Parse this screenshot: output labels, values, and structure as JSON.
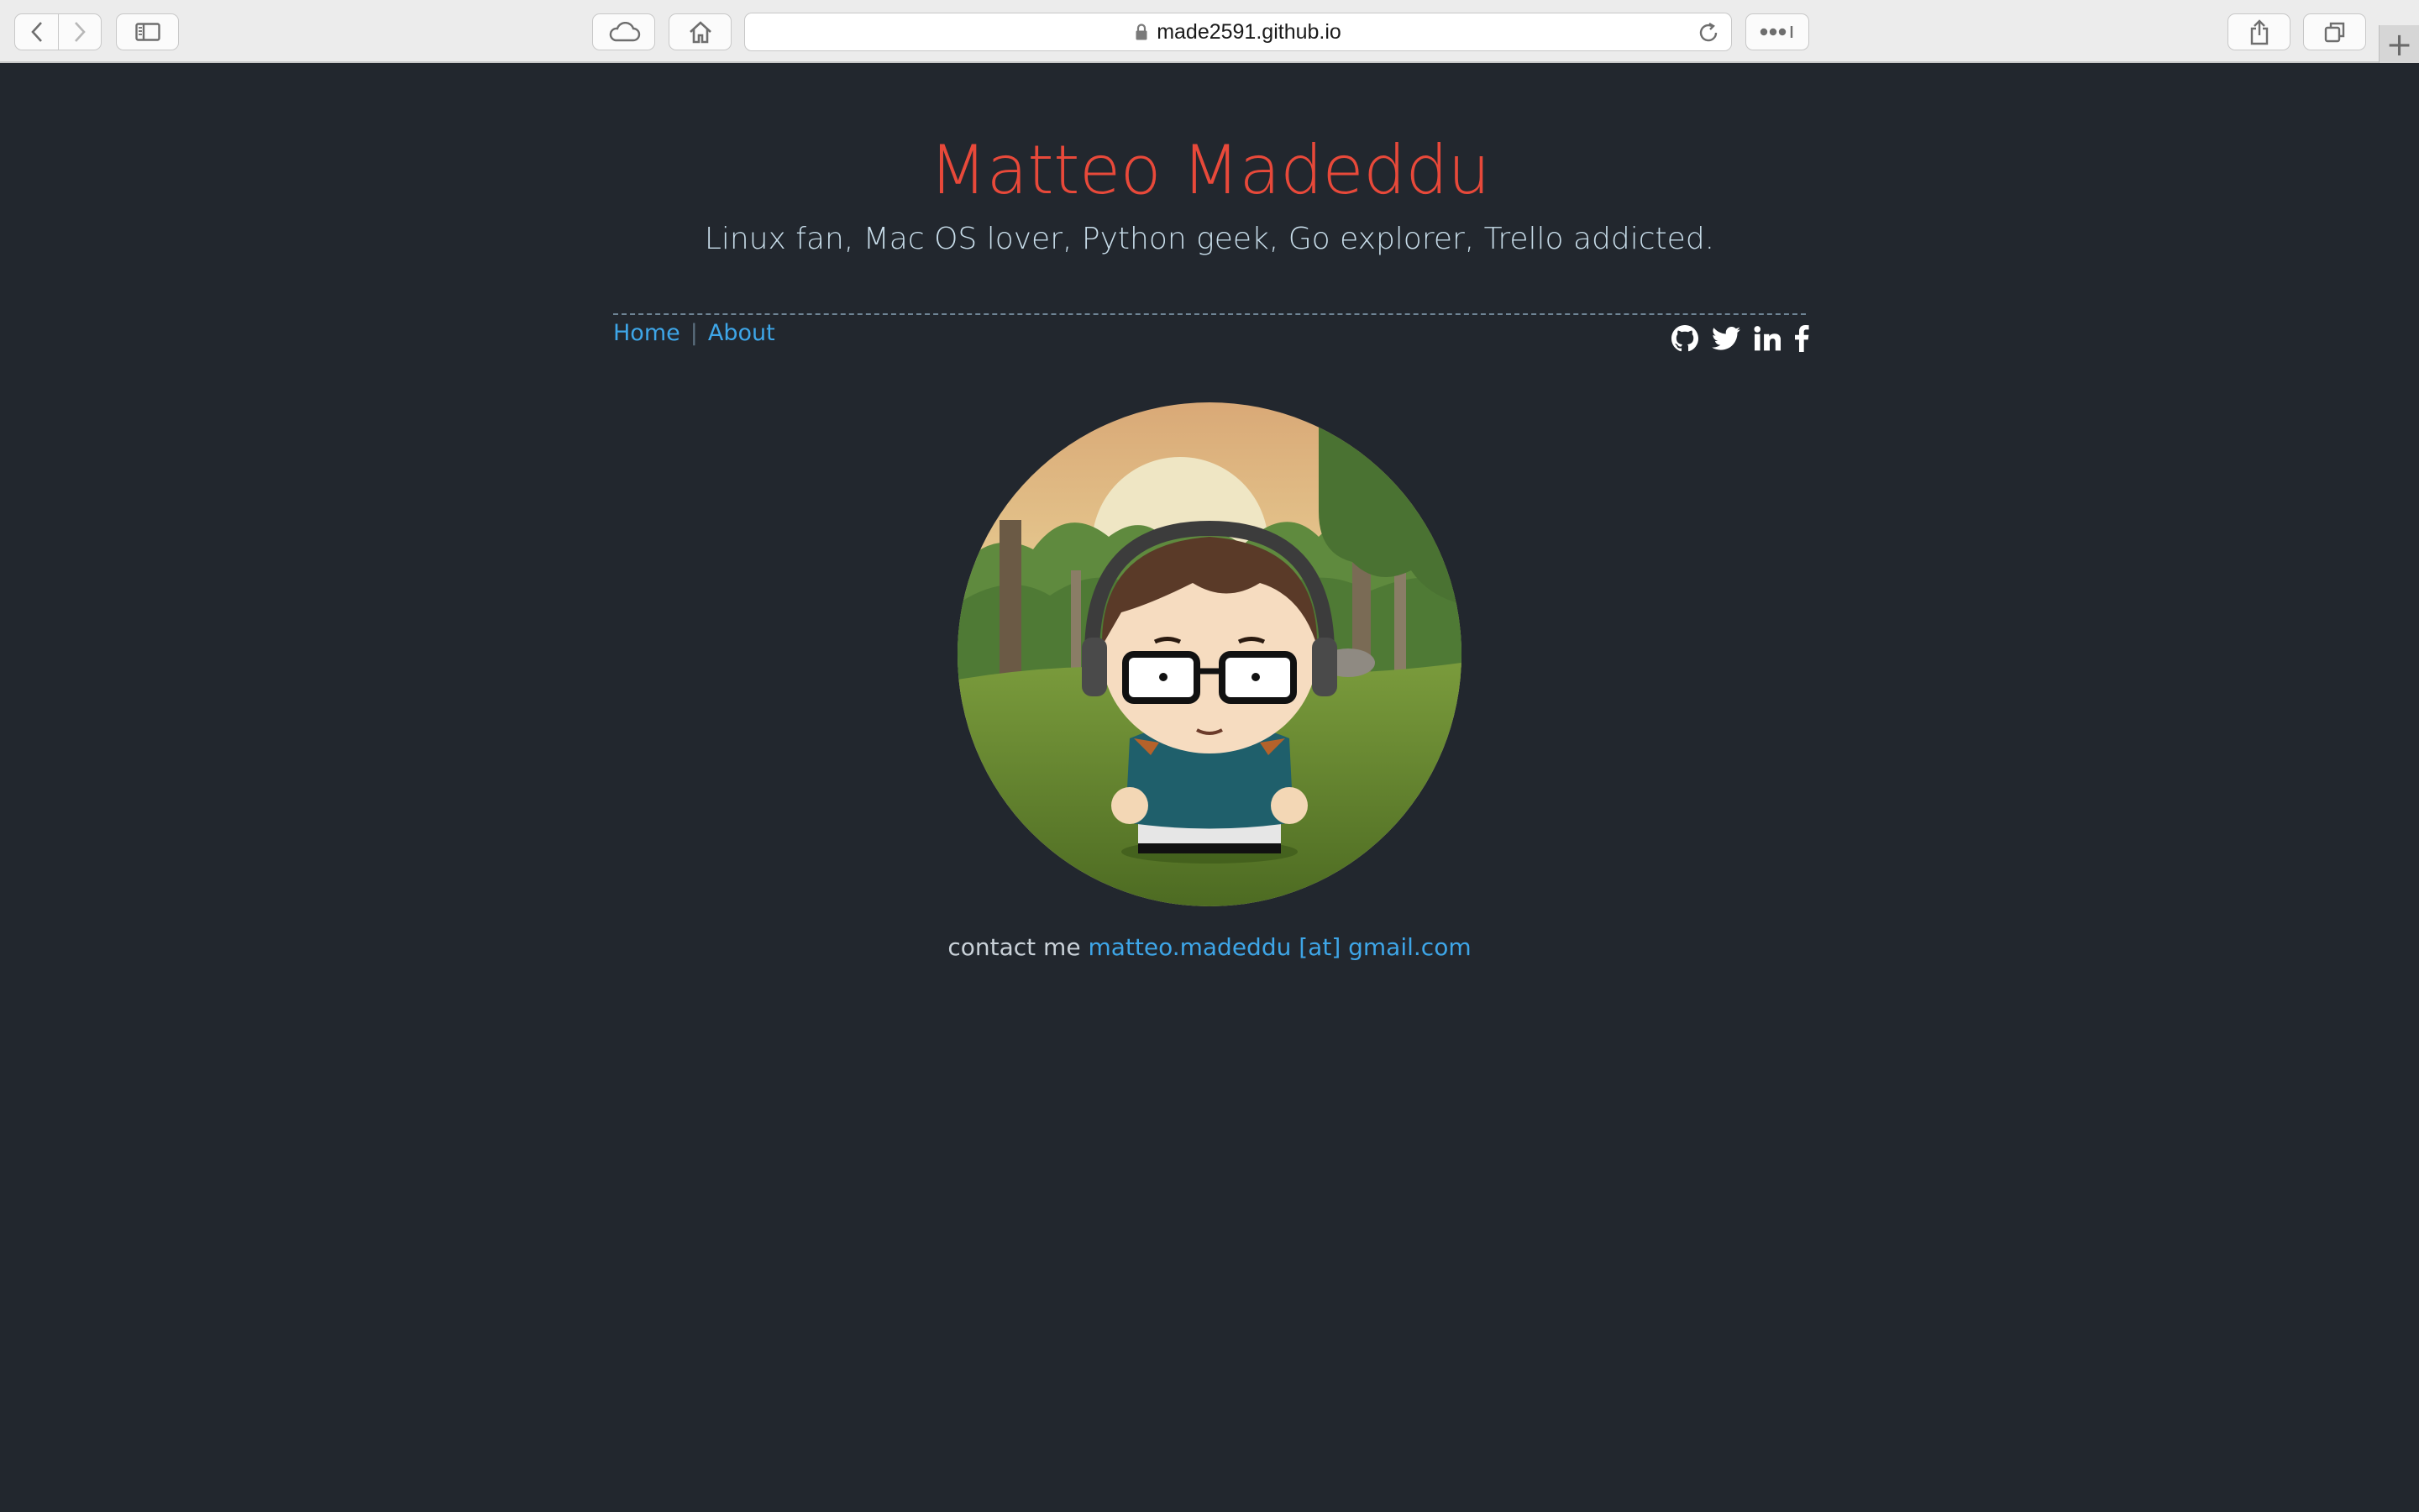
{
  "browser": {
    "url": "made2591.github.io",
    "new_tab_label": "+"
  },
  "site": {
    "title": "Matteo Madeddu",
    "tagline": "Linux fan, Mac OS lover, Python geek, Go explorer, Trello addicted.",
    "title_color": "#e8493a",
    "link_color": "#3ea6e8",
    "background_color": "#22272e"
  },
  "nav": {
    "items": [
      {
        "label": "Home"
      },
      {
        "label": "About"
      }
    ],
    "separator": "|"
  },
  "social": {
    "icons": [
      "github-icon",
      "twitter-icon",
      "linkedin-icon",
      "facebook-icon"
    ]
  },
  "contact": {
    "prefix": "contact me",
    "email": "matteo.madeddu [at] gmail.com"
  }
}
